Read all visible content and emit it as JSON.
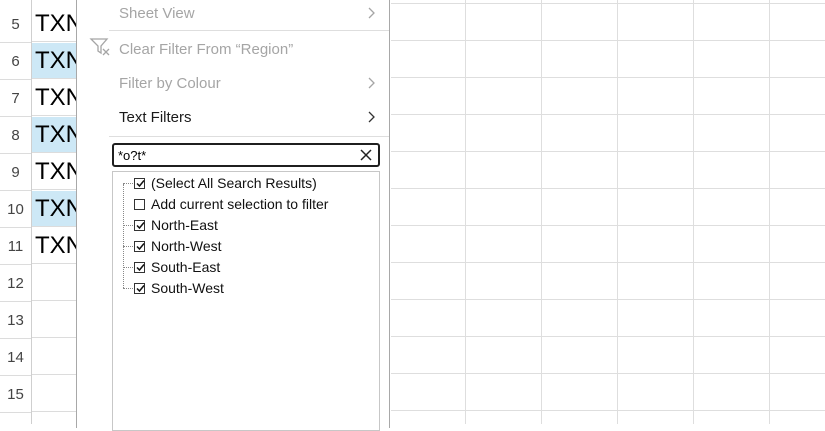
{
  "rows": [
    {
      "number": "5",
      "cell": "TXN",
      "shaded": false
    },
    {
      "number": "6",
      "cell": "TXN",
      "shaded": true
    },
    {
      "number": "7",
      "cell": "TXN",
      "shaded": false
    },
    {
      "number": "8",
      "cell": "TXN",
      "shaded": true
    },
    {
      "number": "9",
      "cell": "TXN",
      "shaded": false
    },
    {
      "number": "10",
      "cell": "TXN",
      "shaded": true
    },
    {
      "number": "11",
      "cell": "TXN",
      "shaded": false
    },
    {
      "number": "12",
      "cell": "",
      "shaded": false
    },
    {
      "number": "13",
      "cell": "",
      "shaded": false
    },
    {
      "number": "14",
      "cell": "",
      "shaded": false
    },
    {
      "number": "15",
      "cell": "",
      "shaded": false
    }
  ],
  "menu": {
    "sheet_view": "Sheet View",
    "clear_filter": "Clear Filter From “Region”",
    "filter_by_colour": "Filter by Colour",
    "text_filters": "Text Filters"
  },
  "search": {
    "value": "*o?t*"
  },
  "filter_list": {
    "select_all": {
      "label": "(Select All Search Results)",
      "checked": true
    },
    "add_selection": {
      "label": "Add current selection to filter",
      "checked": false
    },
    "items": [
      {
        "label": "North-East",
        "checked": true
      },
      {
        "label": "North-West",
        "checked": true
      },
      {
        "label": "South-East",
        "checked": true
      },
      {
        "label": "South-West",
        "checked": true
      }
    ]
  },
  "colors": {
    "shaded_cell": "#cde8f6",
    "disabled_text": "#a5a5a5"
  }
}
